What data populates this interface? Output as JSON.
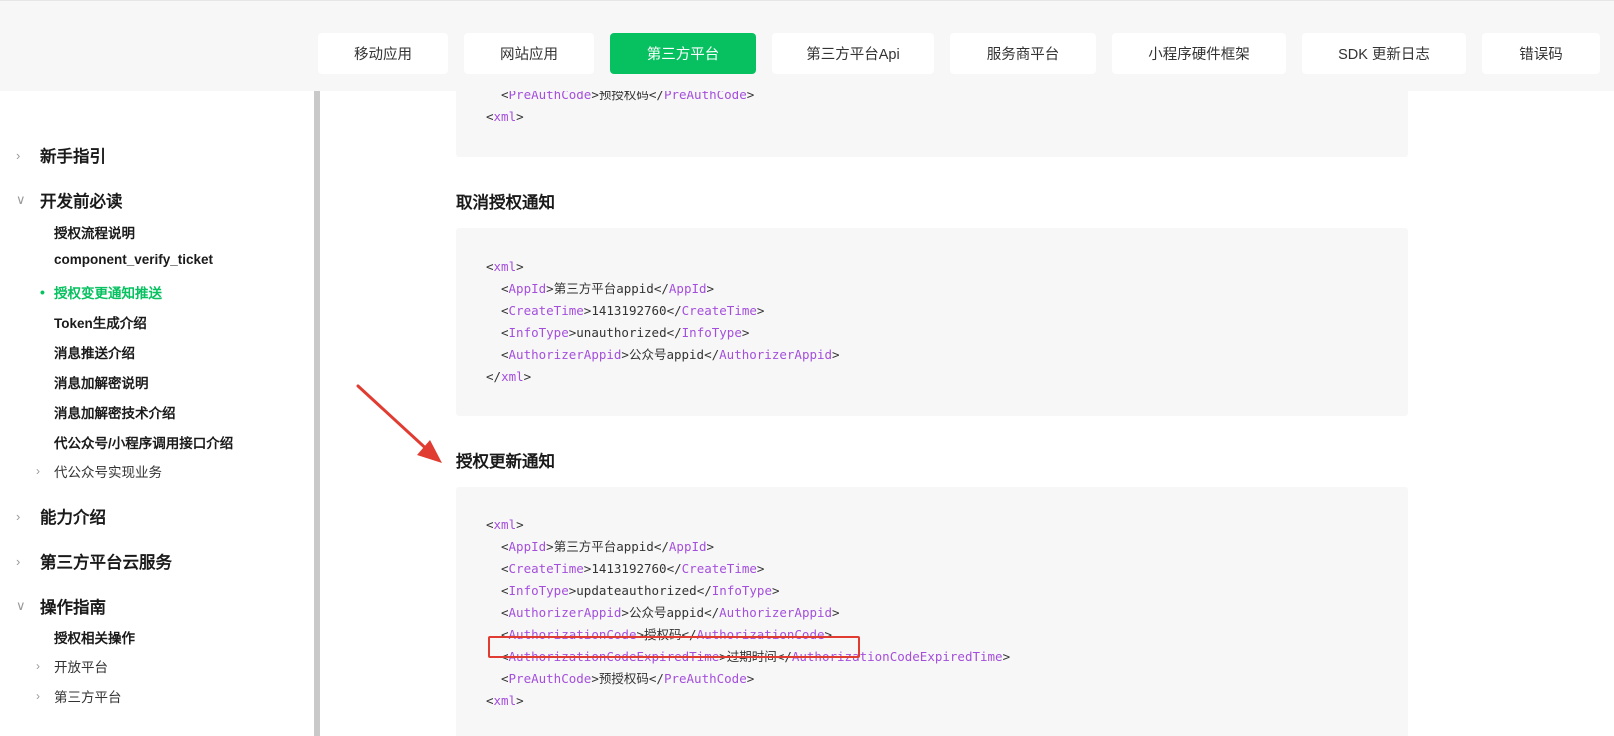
{
  "nav": {
    "tabs": [
      {
        "label": "移动应用",
        "active": false
      },
      {
        "label": "网站应用",
        "active": false
      },
      {
        "label": "第三方平台",
        "active": true
      },
      {
        "label": "第三方平台Api",
        "active": false
      },
      {
        "label": "服务商平台",
        "active": false
      },
      {
        "label": "小程序硬件框架",
        "active": false
      },
      {
        "label": "SDK 更新日志",
        "active": false
      },
      {
        "label": "错误码",
        "active": false
      }
    ]
  },
  "sidebar": {
    "items": [
      {
        "label": "新手指引",
        "level": 1,
        "expanded": false
      },
      {
        "label": "开发前必读",
        "level": 1,
        "expanded": true
      },
      {
        "label": "授权流程说明",
        "level": 2
      },
      {
        "label": "component_verify_ticket",
        "level": 2
      },
      {
        "label": "授权变更通知推送",
        "level": 2,
        "active": true
      },
      {
        "label": "Token生成介绍",
        "level": 2
      },
      {
        "label": "消息推送介绍",
        "level": 2
      },
      {
        "label": "消息加解密说明",
        "level": 2
      },
      {
        "label": "消息加解密技术介绍",
        "level": 2
      },
      {
        "label": "代公众号/小程序调用接口介绍",
        "level": 2
      },
      {
        "label": "代公众号实现业务",
        "level": 2,
        "collapsible": true
      },
      {
        "label": "能力介绍",
        "level": 1,
        "expanded": false
      },
      {
        "label": "第三方平台云服务",
        "level": 1,
        "expanded": false
      },
      {
        "label": "操作指南",
        "level": 1,
        "expanded": true
      },
      {
        "label": "授权相关操作",
        "level": 2
      },
      {
        "label": "开放平台",
        "level": 2,
        "collapsible": true
      },
      {
        "label": "第三方平台",
        "level": 2,
        "collapsible": true
      }
    ]
  },
  "main": {
    "top_code_tail": [
      {
        "open": "PreAuthCode",
        "text": "预授权码",
        "close": "PreAuthCode"
      },
      {
        "raw": "<xml>"
      }
    ],
    "sections": [
      {
        "title": "取消授权通知",
        "lines": [
          {
            "raw": "<xml>"
          },
          {
            "open": "AppId",
            "text": "第三方平台appid",
            "close": "AppId"
          },
          {
            "open": "CreateTime",
            "text": "1413192760",
            "close": "CreateTime"
          },
          {
            "open": "InfoType",
            "text": "unauthorized",
            "close": "InfoType"
          },
          {
            "open": "AuthorizerAppid",
            "text": "公众号appid",
            "close": "AuthorizerAppid"
          },
          {
            "raw": "</xml>"
          }
        ]
      },
      {
        "title": "授权更新通知",
        "lines": [
          {
            "raw": "<xml>"
          },
          {
            "open": "AppId",
            "text": "第三方平台appid",
            "close": "AppId"
          },
          {
            "open": "CreateTime",
            "text": "1413192760",
            "close": "CreateTime"
          },
          {
            "open": "InfoType",
            "text": "updateauthorized",
            "close": "InfoType"
          },
          {
            "open": "AuthorizerAppid",
            "text": "公众号appid",
            "close": "AuthorizerAppid"
          },
          {
            "open": "AuthorizationCode",
            "text": "授权码",
            "close": "AuthorizationCode"
          },
          {
            "open": "AuthorizationCodeExpiredTime",
            "text": "过期时间",
            "close": "AuthorizationCodeExpiredTime"
          },
          {
            "open": "PreAuthCode",
            "text": "预授权码",
            "close": "PreAuthCode"
          },
          {
            "raw": "<xml>"
          }
        ]
      }
    ]
  },
  "colors": {
    "accent": "#07c160",
    "tag": "#a44fdc",
    "annotation": "#e03c31"
  }
}
